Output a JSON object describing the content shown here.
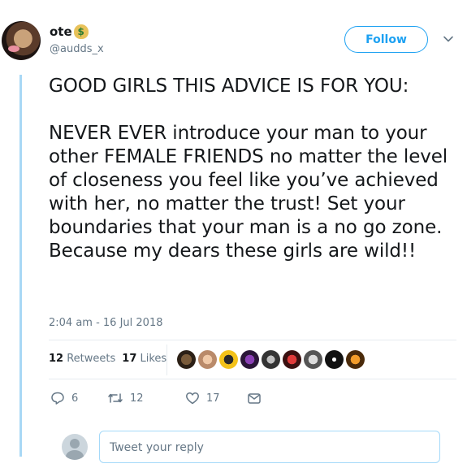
{
  "user": {
    "display_name": "ote",
    "emoji": "$",
    "handle": "@audds_x"
  },
  "follow_label": "Follow",
  "tweet": {
    "text": "GOOD GIRLS THIS ADVICE IS FOR YOU:\n\nNEVER EVER introduce your man to your other FEMALE FRIENDS no matter the level of closeness you feel like you’ve achieved with her, no matter the trust! Set your boundaries that your man is a no go zone. Because my dears these girls are wild!!",
    "timestamp": "2:04 am - 16 Jul 2018"
  },
  "stats": {
    "retweets_count": "12",
    "retweets_label": "Retweets",
    "likes_count": "17",
    "likes_label": "Likes"
  },
  "actions": {
    "replies": "6",
    "retweets": "12",
    "likes": "17"
  },
  "reply_placeholder": "Tweet your reply",
  "colors": {
    "accent": "#1da1f2",
    "thread_line": "#a8d8f5",
    "muted": "#657786"
  }
}
